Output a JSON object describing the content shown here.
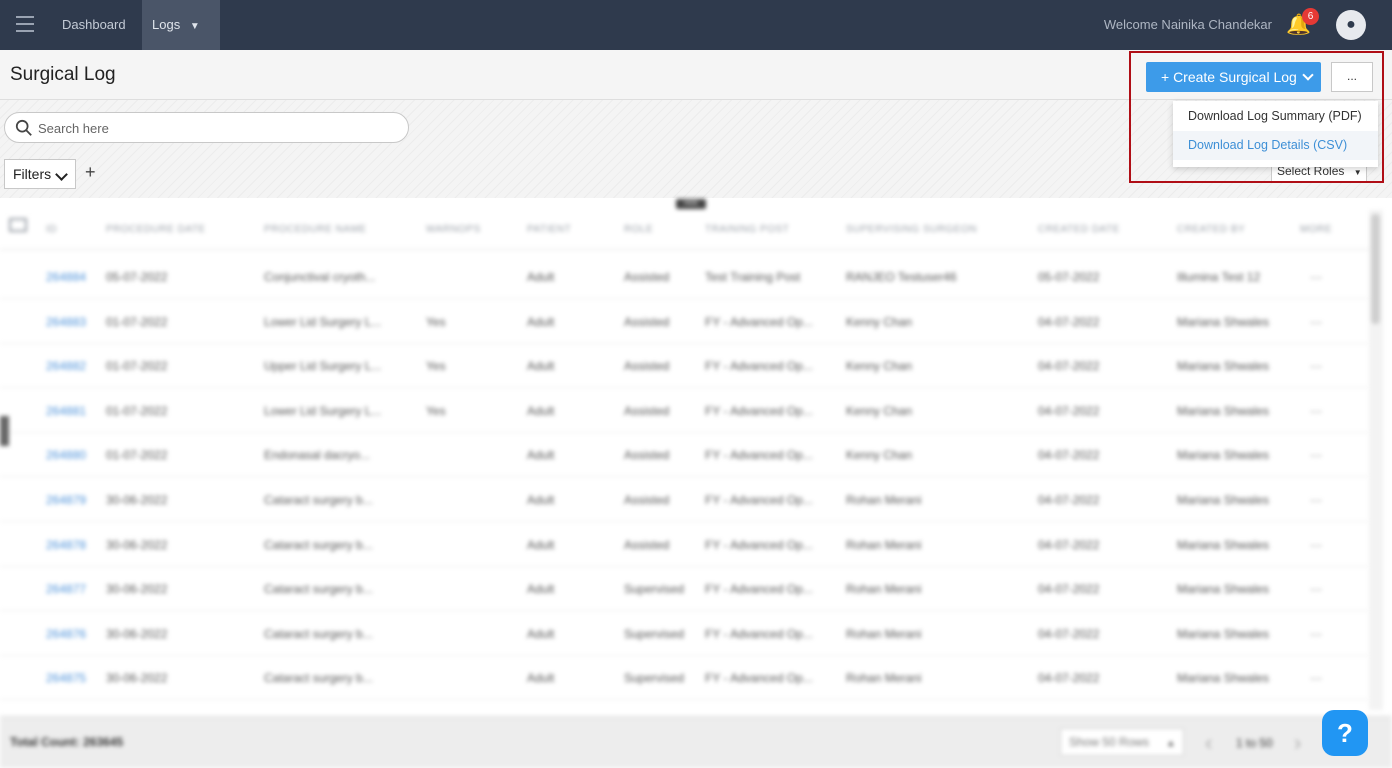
{
  "topnav": {
    "dashboard_label": "Dashboard",
    "log_label": "Logs",
    "welcome_text": "Welcome Nainika Chandekar",
    "notification_count": "6"
  },
  "page": {
    "title": "Surgical Log"
  },
  "search": {
    "placeholder": "Search here"
  },
  "filters": {
    "label": "Filters",
    "add_label": "+",
    "roles_label": "Select Roles"
  },
  "actions": {
    "create_label": "+ Create Surgical Log",
    "more_label": "...",
    "menu": [
      {
        "label": "Download Log Summary (PDF)"
      },
      {
        "label": "Download Log Details (CSV)"
      }
    ]
  },
  "table": {
    "toggle_label": "HIDE",
    "columns": [
      "ID",
      "PROCEDURE DATE",
      "PROCEDURE NAME",
      "WARNOPS",
      "PATIENT",
      "ROLE",
      "TRAINING POST",
      "SUPERVISING SURGEON",
      "CREATED DATE",
      "CREATED BY",
      "MORE"
    ],
    "rows": [
      [
        "264884",
        "05-07-2022",
        "Conjunctival cryoth...",
        "",
        "Adult",
        "Assisted",
        "Test Training Post",
        "RANJEO Testuser46",
        "05-07-2022",
        "Illumina Test 12",
        "···"
      ],
      [
        "264883",
        "01-07-2022",
        "Lower Lid Surgery L...",
        "Yes",
        "Adult",
        "Assisted",
        "FY - Advanced Op...",
        "Kenny Chan",
        "04-07-2022",
        "Mariana Shwales",
        "···"
      ],
      [
        "264882",
        "01-07-2022",
        "Upper Lid Surgery L...",
        "Yes",
        "Adult",
        "Assisted",
        "FY - Advanced Op...",
        "Kenny Chan",
        "04-07-2022",
        "Mariana Shwales",
        "···"
      ],
      [
        "264881",
        "01-07-2022",
        "Lower Lid Surgery L...",
        "Yes",
        "Adult",
        "Assisted",
        "FY - Advanced Op...",
        "Kenny Chan",
        "04-07-2022",
        "Mariana Shwales",
        "···"
      ],
      [
        "264880",
        "01-07-2022",
        "Endonasal dacryo...",
        "",
        "Adult",
        "Assisted",
        "FY - Advanced Op...",
        "Kenny Chan",
        "04-07-2022",
        "Mariana Shwales",
        "···"
      ],
      [
        "264879",
        "30-06-2022",
        "Cataract surgery b...",
        "",
        "Adult",
        "Assisted",
        "FY - Advanced Op...",
        "Rohan Merani",
        "04-07-2022",
        "Mariana Shwales",
        "···"
      ],
      [
        "264878",
        "30-06-2022",
        "Cataract surgery b...",
        "",
        "Adult",
        "Assisted",
        "FY - Advanced Op...",
        "Rohan Merani",
        "04-07-2022",
        "Mariana Shwales",
        "···"
      ],
      [
        "264877",
        "30-06-2022",
        "Cataract surgery b...",
        "",
        "Adult",
        "Supervised",
        "FY - Advanced Op...",
        "Rohan Merani",
        "04-07-2022",
        "Mariana Shwales",
        "···"
      ],
      [
        "264876",
        "30-06-2022",
        "Cataract surgery b...",
        "",
        "Adult",
        "Supervised",
        "FY - Advanced Op...",
        "Rohan Merani",
        "04-07-2022",
        "Mariana Shwales",
        "···"
      ],
      [
        "264875",
        "30-06-2022",
        "Cataract surgery b...",
        "",
        "Adult",
        "Supervised",
        "FY - Advanced Op...",
        "Rohan Merani",
        "04-07-2022",
        "Mariana Shwales",
        "···"
      ]
    ]
  },
  "footer": {
    "total_label": "Total Count: 263645",
    "rows_label": "Show 50 Rows",
    "page_label": "1 to 50"
  },
  "help": {
    "label": "?"
  },
  "colors": {
    "nav_bg": "#2f3a4d",
    "primary": "#3d9be9",
    "link": "#4a90d9",
    "highlight": "#b00e16",
    "badge": "#e53935"
  }
}
